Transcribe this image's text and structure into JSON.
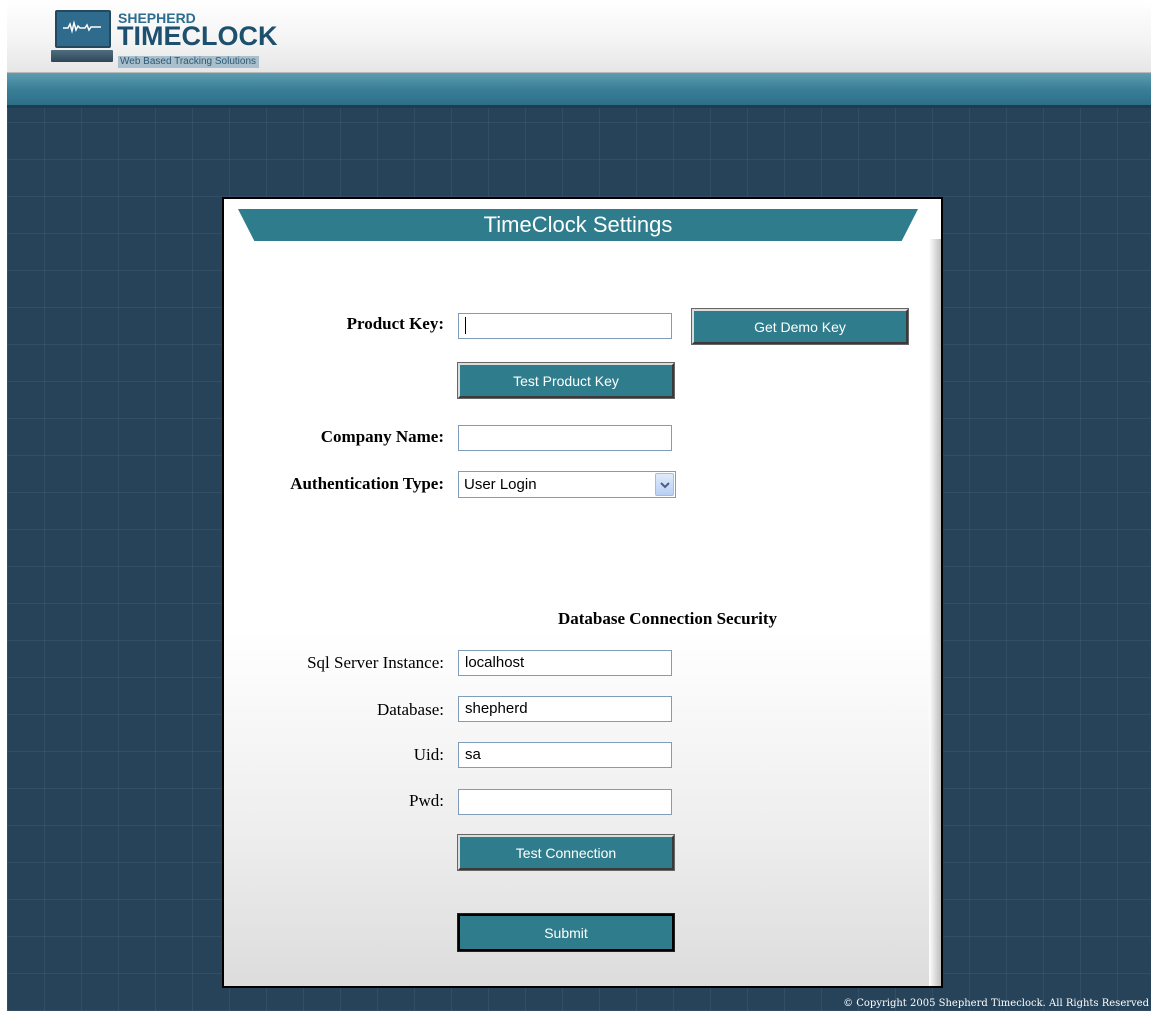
{
  "header": {
    "brand_top": "SHEPHERD",
    "brand_main": "TIMECLOCK",
    "brand_sub": "Web Based Tracking Solutions"
  },
  "panel": {
    "title": "TimeClock Settings",
    "product_key": {
      "label": "Product Key:",
      "value": ""
    },
    "get_demo_key_button": "Get Demo Key",
    "test_product_key_button": "Test Product Key",
    "company_name": {
      "label": "Company Name:",
      "value": ""
    },
    "auth_type": {
      "label": "Authentication Type:",
      "selected": "User Login"
    },
    "db_section_title": "Database Connection Security",
    "sql_server_instance": {
      "label": "Sql Server Instance:",
      "value": "localhost"
    },
    "database": {
      "label": "Database:",
      "value": "shepherd"
    },
    "uid": {
      "label": "Uid:",
      "value": "sa"
    },
    "pwd": {
      "label": "Pwd:",
      "value": ""
    },
    "test_connection_button": "Test Connection",
    "submit_button": "Submit"
  },
  "footer": {
    "copyright": "© Copyright 2005 Shepherd Timeclock. All Rights Reserved"
  },
  "colors": {
    "accent_teal": "#2f7d8c",
    "background_navy": "#26435a",
    "brand_blue": "#1d4f6e"
  },
  "icons": {
    "logo": "computer-monitor-icon",
    "dropdown": "chevron-down-icon"
  }
}
